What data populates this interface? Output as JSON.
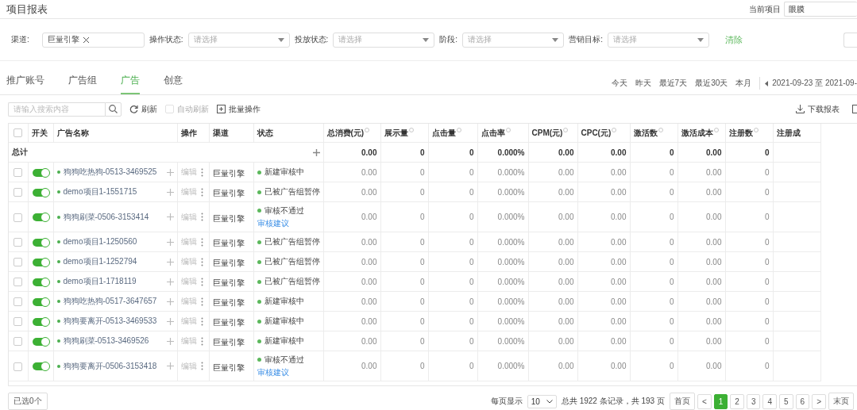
{
  "page_title": "项目报表",
  "current_project": {
    "label": "当前项目",
    "value": "眼膜"
  },
  "filters": [
    {
      "kind": "tags",
      "label": "渠道:",
      "tags": [
        "巨量引擎"
      ]
    },
    {
      "kind": "select",
      "label": "操作状态:",
      "placeholder": "请选择"
    },
    {
      "kind": "select",
      "label": "投放状态:",
      "placeholder": "请选择"
    },
    {
      "kind": "select",
      "label": "阶段:",
      "placeholder": "请选择"
    },
    {
      "kind": "select",
      "label": "营销目标:",
      "placeholder": "请选择"
    }
  ],
  "clear_link": "清除",
  "tabs": [
    {
      "label": "推广账号",
      "selected": false
    },
    {
      "label": "广告组",
      "selected": false
    },
    {
      "label": "广告",
      "selected": true
    },
    {
      "label": "创意",
      "selected": false
    }
  ],
  "date_shortcuts": [
    "今天",
    "昨天",
    "最近7天",
    "最近30天",
    "本月"
  ],
  "date_range": "2021-09-23 至 2021-09-",
  "search": {
    "placeholder": "请输入搜索内容"
  },
  "toolbar": {
    "refresh": "刷新",
    "auto_refresh": {
      "label": "自动刷新",
      "checked": false
    },
    "batch": "批量操作",
    "download": "下载报表"
  },
  "table": {
    "select_all": {
      "checked": false
    },
    "columns": [
      {
        "label": "开关"
      },
      {
        "label": "广告名称"
      },
      {
        "label": "操作"
      },
      {
        "label": "渠道"
      },
      {
        "label": "状态"
      },
      {
        "label": "总消费(元)",
        "info": true
      },
      {
        "label": "展示量",
        "info": true
      },
      {
        "label": "点击量",
        "info": true
      },
      {
        "label": "点击率",
        "info": true
      },
      {
        "label": "CPM(元)",
        "info": true
      },
      {
        "label": "CPC(元)",
        "info": true
      },
      {
        "label": "激活数",
        "info": true
      },
      {
        "label": "激活成本",
        "info": true
      },
      {
        "label": "注册数",
        "info": true
      },
      {
        "label": "注册成",
        "info": false
      }
    ],
    "total": {
      "label": "总计",
      "values": [
        "0.00",
        "0",
        "0",
        "0.000%",
        "0.00",
        "0.00",
        "0",
        "0.00",
        "0"
      ]
    },
    "rows": [
      {
        "checked": false,
        "on": true,
        "name": "狗狗吃热狗-0513-3469525",
        "edit": "编辑",
        "channel": "巨量引擎",
        "status": "新建审核中",
        "values": [
          "0.00",
          "0",
          "0",
          "0.000%",
          "0.00",
          "0.00",
          "0",
          "0.00",
          "0"
        ]
      },
      {
        "checked": false,
        "on": true,
        "name": "demo项目1-1551715",
        "edit": "编辑",
        "channel": "巨量引擎",
        "status": "已被广告组暂停",
        "values": [
          "0.00",
          "0",
          "0",
          "0.000%",
          "0.00",
          "0.00",
          "0",
          "0.00",
          "0"
        ]
      },
      {
        "checked": false,
        "on": true,
        "name": "狗狗刷菜-0506-3153414",
        "edit": "编辑",
        "channel": "巨量引擎",
        "status": "审核不通过",
        "advice": "审核建议",
        "values": [
          "0.00",
          "0",
          "0",
          "0.000%",
          "0.00",
          "0.00",
          "0",
          "0.00",
          "0"
        ]
      },
      {
        "checked": false,
        "on": true,
        "name": "demo项目1-1250560",
        "edit": "编辑",
        "channel": "巨量引擎",
        "status": "已被广告组暂停",
        "values": [
          "0.00",
          "0",
          "0",
          "0.000%",
          "0.00",
          "0.00",
          "0",
          "0.00",
          "0"
        ]
      },
      {
        "checked": false,
        "on": true,
        "name": "demo项目1-1252794",
        "edit": "编辑",
        "channel": "巨量引擎",
        "status": "已被广告组暂停",
        "values": [
          "0.00",
          "0",
          "0",
          "0.000%",
          "0.00",
          "0.00",
          "0",
          "0.00",
          "0"
        ]
      },
      {
        "checked": false,
        "on": true,
        "name": "demo项目1-1718119",
        "edit": "编辑",
        "channel": "巨量引擎",
        "status": "已被广告组暂停",
        "values": [
          "0.00",
          "0",
          "0",
          "0.000%",
          "0.00",
          "0.00",
          "0",
          "0.00",
          "0"
        ]
      },
      {
        "checked": false,
        "on": true,
        "name": "狗狗吃热狗-0517-3647657",
        "edit": "编辑",
        "channel": "巨量引擎",
        "status": "新建审核中",
        "values": [
          "0.00",
          "0",
          "0",
          "0.000%",
          "0.00",
          "0.00",
          "0",
          "0.00",
          "0"
        ]
      },
      {
        "checked": false,
        "on": true,
        "name": "狗狗要离开-0513-3469533",
        "edit": "编辑",
        "channel": "巨量引擎",
        "status": "新建审核中",
        "values": [
          "0.00",
          "0",
          "0",
          "0.000%",
          "0.00",
          "0.00",
          "0",
          "0.00",
          "0"
        ]
      },
      {
        "checked": false,
        "on": true,
        "name": "狗狗刷菜-0513-3469526",
        "edit": "编辑",
        "channel": "巨量引擎",
        "status": "新建审核中",
        "values": [
          "0.00",
          "0",
          "0",
          "0.000%",
          "0.00",
          "0.00",
          "0",
          "0.00",
          "0"
        ]
      },
      {
        "checked": false,
        "on": true,
        "name": "狗狗要离开-0506-3153418",
        "edit": "编辑",
        "channel": "巨量引擎",
        "status": "审核不通过",
        "advice": "审核建议",
        "values": [
          "0.00",
          "0",
          "0",
          "0.000%",
          "0.00",
          "0.00",
          "0",
          "0.00",
          "0"
        ]
      }
    ]
  },
  "selected_count": "已选0个",
  "pagination": {
    "per_page_label": "每页显示",
    "per_page": "10",
    "summary": "总共 1922 条记录，共 193 页",
    "first": "首页",
    "prev": "<",
    "pages": [
      {
        "label": "1",
        "selected": true
      },
      {
        "label": "2",
        "selected": false
      },
      {
        "label": "3",
        "selected": false
      },
      {
        "label": "4",
        "selected": false
      },
      {
        "label": "5",
        "selected": false
      },
      {
        "label": "6",
        "selected": false
      }
    ],
    "next": ">",
    "last": "末页"
  }
}
